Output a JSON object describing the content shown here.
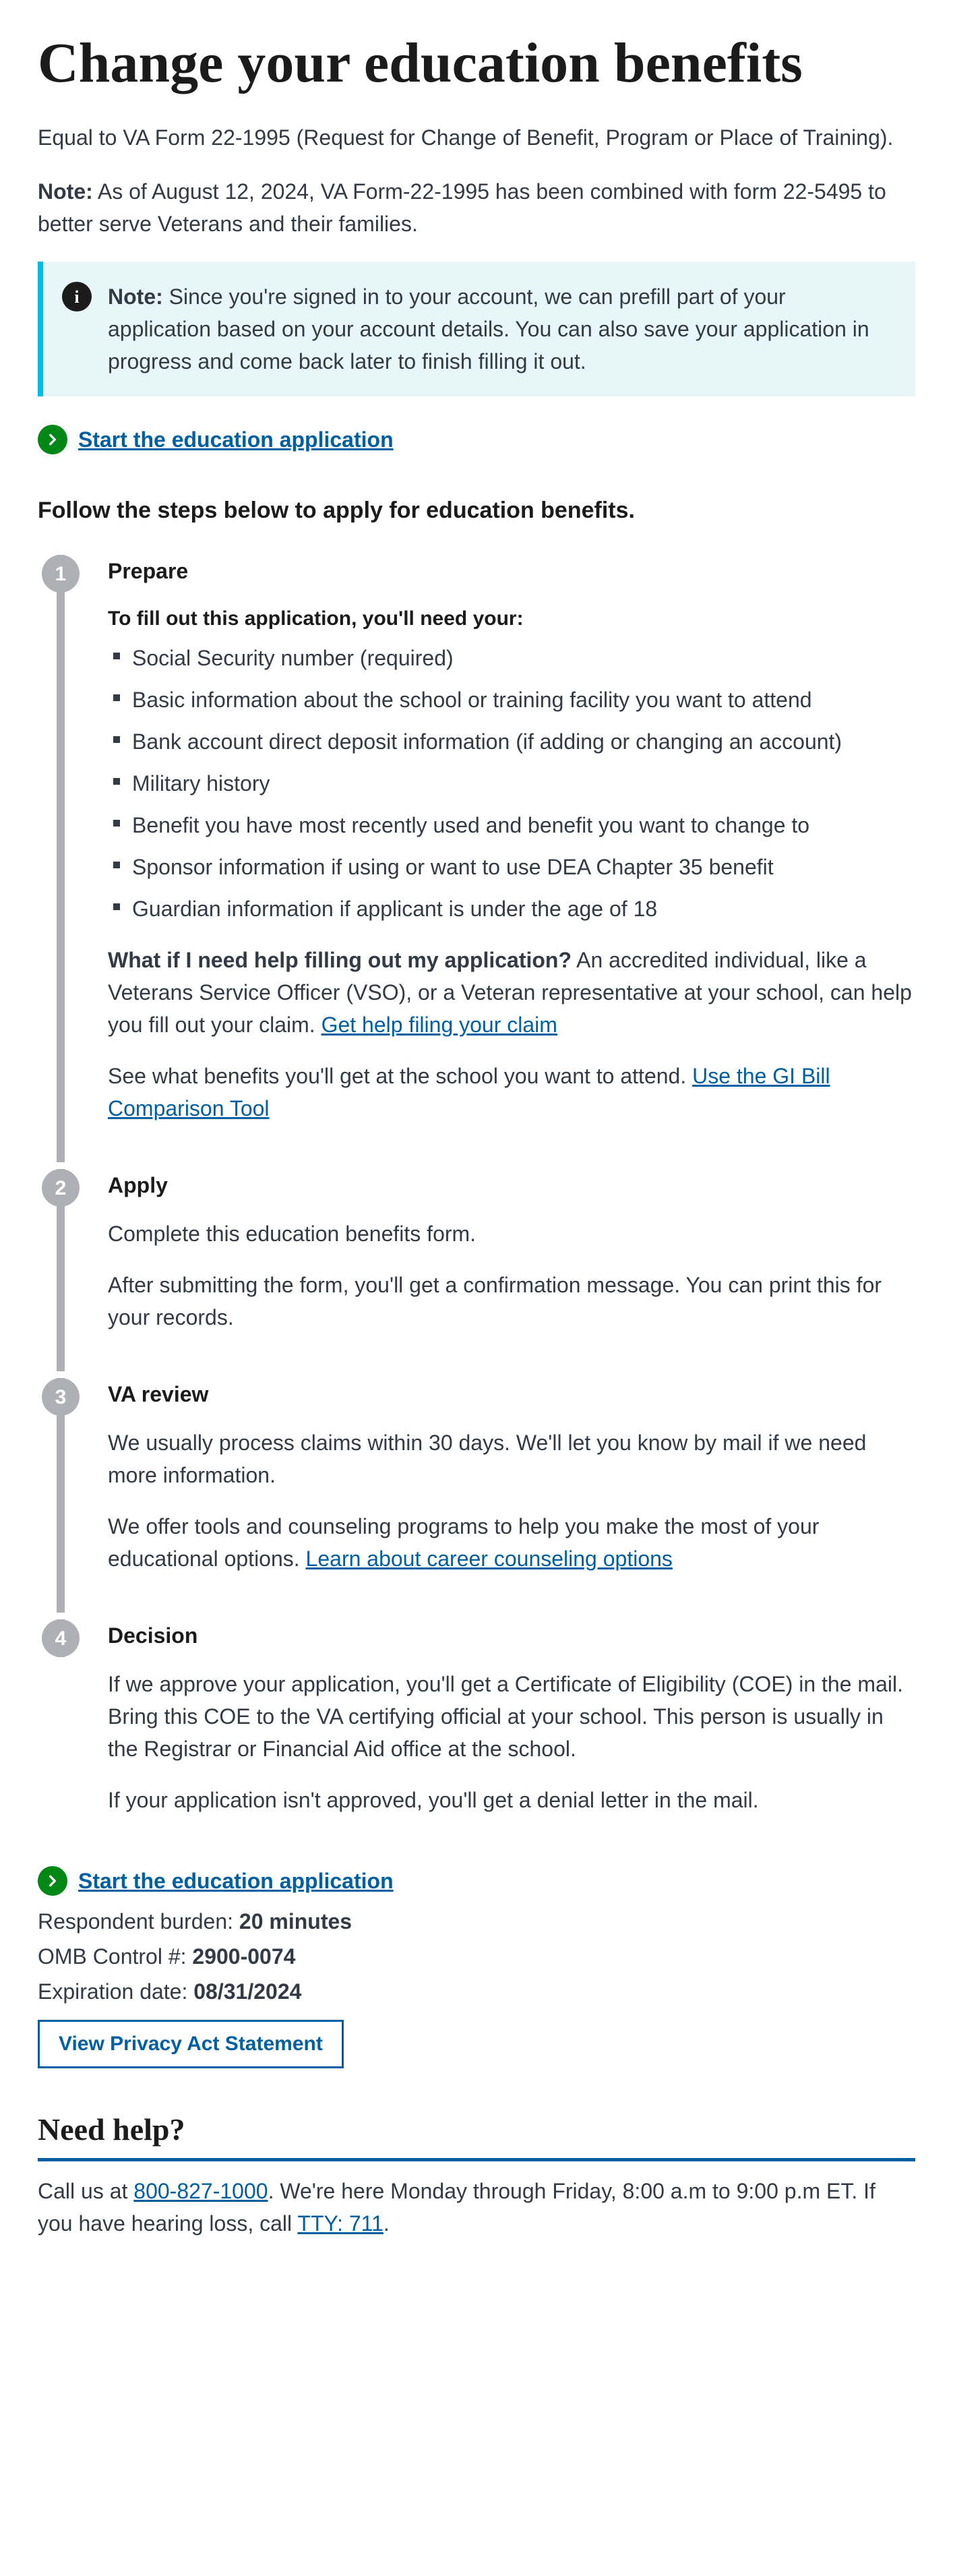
{
  "title": "Change your education benefits",
  "subtitle": "Equal to VA Form 22-1995 (Request for Change of Benefit, Program or Place of Training).",
  "top_note_label": "Note:",
  "top_note_text": " As of August 12, 2024, VA Form-22-1995 has been combined with form 22-5495 to better serve Veterans and their families.",
  "info_note_label": "Note:",
  "info_note_text": " Since you're signed in to your account, we can prefill part of your application based on your account details. You can also save your application in progress and come back later to finish filling it out.",
  "start_link": "Start the education application",
  "follow_heading": "Follow the steps below to apply for education benefits.",
  "steps": {
    "s1": {
      "title": "Prepare",
      "need_header": "To fill out this application, you'll need your:",
      "items": [
        "Social Security number (required)",
        "Basic information about the school or training facility you want to attend",
        "Bank account direct deposit information (if adding or changing an account)",
        "Military history",
        "Benefit you have most recently used and benefit you want to change to",
        "Sponsor information if using or want to use DEA Chapter 35 benefit",
        "Guardian information if applicant is under the age of 18"
      ],
      "help_q": "What if I need help filling out my application?",
      "help_a": " An accredited individual, like a Veterans Service Officer (VSO), or a Veteran representative at your school, can help you fill out your claim. ",
      "help_link": "Get help filing your claim",
      "gi_pre": "See what benefits you'll get at the school you want to attend. ",
      "gi_link": "Use the GI Bill Comparison Tool"
    },
    "s2": {
      "title": "Apply",
      "p1": "Complete this education benefits form.",
      "p2": "After submitting the form, you'll get a confirmation message. You can print this for your records."
    },
    "s3": {
      "title": "VA review",
      "p1": "We usually process claims within 30 days. We'll let you know by mail if we need more information.",
      "p2_pre": "We offer tools and counseling programs to help you make the most of your educational options. ",
      "p2_link": "Learn about career counseling options"
    },
    "s4": {
      "title": "Decision",
      "p1": "If we approve your application, you'll get a Certificate of Eligibility (COE) in the mail. Bring this COE to the VA certifying official at your school. This person is usually in the Registrar or Financial Aid office at the school.",
      "p2": "If your application isn't approved, you'll get a denial letter in the mail."
    }
  },
  "burden_label": "Respondent burden: ",
  "burden_value": "20 minutes",
  "omb_label": "OMB Control #: ",
  "omb_value": "2900-0074",
  "exp_label": "Expiration date: ",
  "exp_value": "08/31/2024",
  "privacy_btn": "View Privacy Act Statement",
  "need_help_heading": "Need help?",
  "help_pre": "Call us at ",
  "help_phone": "800-827-1000",
  "help_mid": ". We're here Monday through Friday, 8:00 a.m to 9:00 p.m ET. If you have hearing loss, call ",
  "help_tty": "TTY: 711",
  "help_post": "."
}
